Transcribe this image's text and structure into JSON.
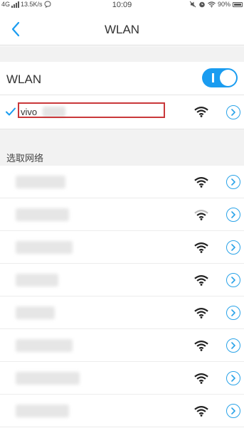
{
  "status_bar": {
    "network_type": "4G",
    "speed": "13.5K/s",
    "time": "10:09",
    "battery": "90%",
    "icons": [
      "signal-icon",
      "chat-bubble-icon",
      "mute-icon",
      "alarm-icon",
      "wifi-icon",
      "battery-icon"
    ]
  },
  "header": {
    "title": "WLAN",
    "back_icon": "chevron-left-icon"
  },
  "wlan_toggle": {
    "label": "WLAN",
    "enabled": true,
    "accent_color": "#1a9cf0"
  },
  "connected_network": {
    "name": "vivo",
    "check_icon": "checkmark-icon",
    "signal_icon": "wifi-icon",
    "detail_icon": "chevron-right-circle-icon",
    "highlight_color": "#c9383a"
  },
  "networks_section": {
    "title": "选取网络"
  },
  "networks": [
    {
      "name": "",
      "signal_icon": "wifi-icon",
      "detail_icon": "chevron-right-circle-icon"
    },
    {
      "name": "",
      "signal_icon": "wifi-icon",
      "detail_icon": "chevron-right-circle-icon"
    },
    {
      "name": "",
      "signal_icon": "wifi-icon",
      "detail_icon": "chevron-right-circle-icon"
    },
    {
      "name": "",
      "signal_icon": "wifi-icon",
      "detail_icon": "chevron-right-circle-icon"
    },
    {
      "name": "",
      "signal_icon": "wifi-icon",
      "detail_icon": "chevron-right-circle-icon"
    },
    {
      "name": "",
      "signal_icon": "wifi-icon",
      "detail_icon": "chevron-right-circle-icon"
    },
    {
      "name": "",
      "signal_icon": "wifi-icon",
      "detail_icon": "chevron-right-circle-icon"
    },
    {
      "name": "",
      "signal_icon": "wifi-icon",
      "detail_icon": "chevron-right-circle-icon"
    }
  ]
}
